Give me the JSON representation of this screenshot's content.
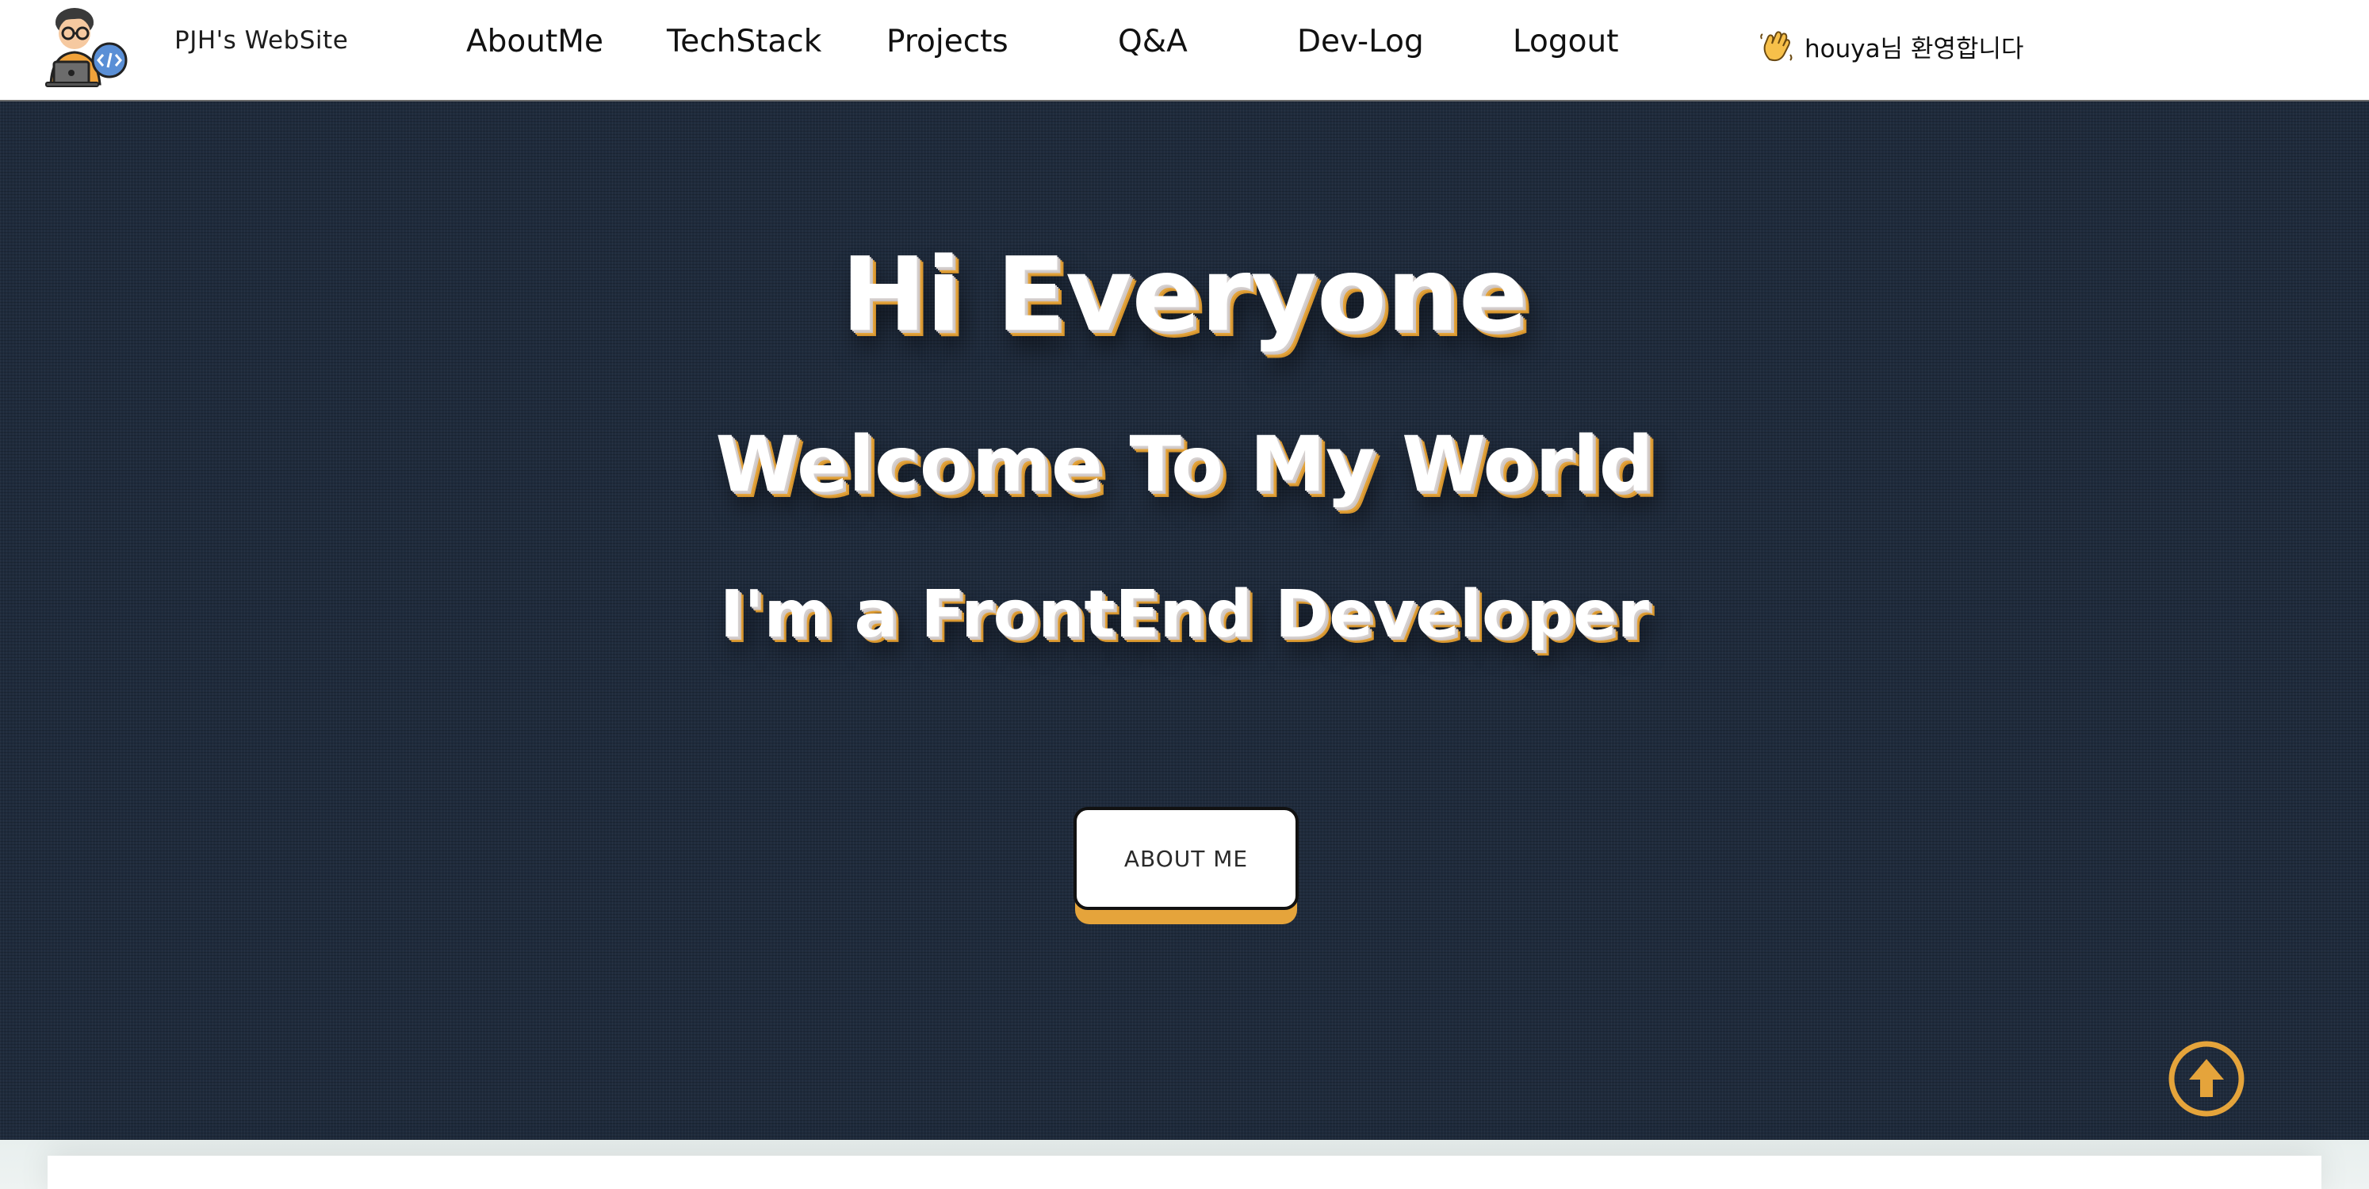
{
  "header": {
    "site_title": "PJH's WebSite",
    "logo_icon": "developer-avatar-icon",
    "nav": [
      {
        "label": "AboutMe"
      },
      {
        "label": "TechStack"
      },
      {
        "label": "Projects"
      },
      {
        "label": "Q&A"
      },
      {
        "label": "Dev-Log"
      },
      {
        "label": "Logout"
      }
    ],
    "greeting": {
      "icon": "waving-hand-icon",
      "text": "houya님 환영합니다"
    }
  },
  "hero": {
    "line1": "Hi Everyone",
    "line2": "Welcome To My World",
    "line3": "I'm a FrontEnd Developer",
    "button_label": "ABOUT ME",
    "scroll_top_icon": "arrow-up-circle-icon"
  },
  "colors": {
    "accent": "#e5a43b",
    "hero_background": "#1f2b3c",
    "text_light": "#ffffff",
    "text_dark": "#111111"
  }
}
